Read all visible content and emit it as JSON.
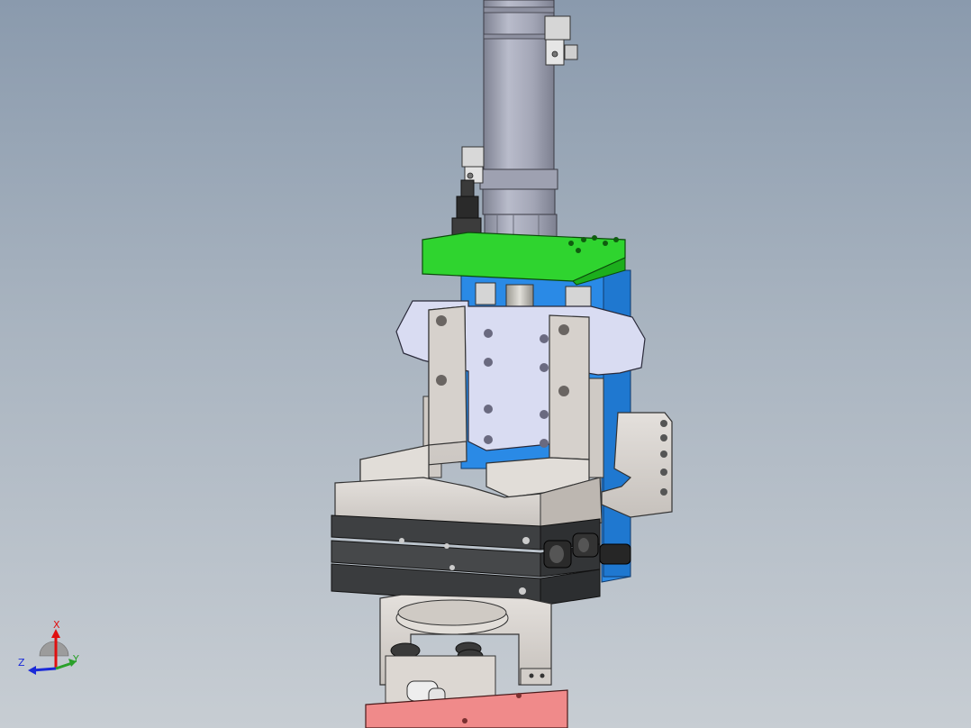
{
  "viewport": {
    "background_top": "#8a9aad",
    "background_bottom": "#c7cdd3"
  },
  "colors": {
    "cylinder": "#a7aab9",
    "cylinder_dark": "#8f92a2",
    "top_plate": "#2fd42f",
    "blue_frame": "#2a8ae6",
    "bracket": "#d9dcf2",
    "gray_part": "#d8d3cf",
    "slide_dark": "#3e4042",
    "base_red": "#f08a8a"
  },
  "orientation_triad": {
    "x_label": "X",
    "y_label": "Y",
    "z_label": "Z",
    "x_color": "#e01010",
    "y_color": "#2aa02a",
    "z_color": "#1a2ad8"
  }
}
